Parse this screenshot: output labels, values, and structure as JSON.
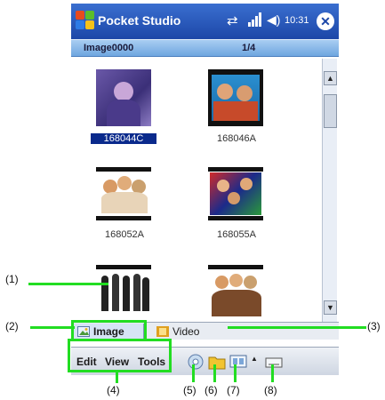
{
  "app": {
    "title": "Pocket Studio",
    "clock": "10:31",
    "close_label": "✕"
  },
  "header": {
    "folder_name": "Image0000",
    "page_indicator": "1/4"
  },
  "thumbnails": [
    {
      "label": "168044C",
      "selected": true
    },
    {
      "label": "168046A",
      "selected": false
    },
    {
      "label": "168052A",
      "selected": false
    },
    {
      "label": "168055A",
      "selected": false
    },
    {
      "label": "",
      "selected": false
    },
    {
      "label": "",
      "selected": false
    }
  ],
  "tabs": {
    "image": "Image",
    "video": "Video"
  },
  "menu": {
    "edit": "Edit",
    "view": "View",
    "tools": "Tools"
  },
  "callouts": {
    "c1": "(1)",
    "c2": "(2)",
    "c3": "(3)",
    "c4": "(4)",
    "c5": "(5)",
    "c6": "(6)",
    "c7": "(7)",
    "c8": "(8)"
  },
  "colors": {
    "annotation": "#22dd22",
    "title_bar": "#1c47a8",
    "selection": "#0a2a8c"
  },
  "icons": [
    "windows-start-icon",
    "sync-icon",
    "signal-icon",
    "speaker-icon",
    "close-icon",
    "toolbar-disc-icon",
    "toolbar-folder-icon",
    "toolbar-display-icon",
    "keyboard-icon"
  ]
}
